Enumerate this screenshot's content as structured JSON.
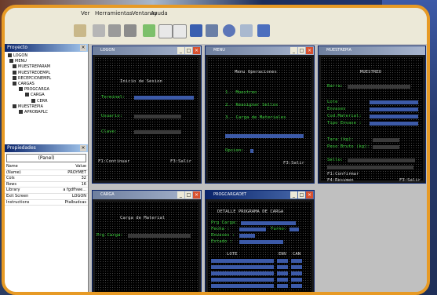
{
  "menu": {
    "item1": "Ver",
    "item2": "Herramientas",
    "item3": "Ventanas",
    "item4": "Ayuda"
  },
  "explorer": {
    "title": "Proyecto",
    "items": [
      "LOGON",
      "MENU",
      "MUESTREPARAM",
      "MUESTREOEMPL",
      "RECEPCIONEMPL",
      "CARGAS",
      "PROGCARGA",
      "CARGA",
      "CERR",
      "MUESTREPIA",
      "APROBAPLC"
    ]
  },
  "properties": {
    "title": "Propiedades",
    "selected": "(Panel)",
    "header": {
      "name": "Name",
      "value": "Value"
    },
    "rows": [
      {
        "name": "(Name)",
        "value": "PROYMET"
      },
      {
        "name": "Cols",
        "value": "32"
      },
      {
        "name": "Rows",
        "value": "16"
      },
      {
        "name": "Library",
        "value": "a fgdfhwe..."
      },
      {
        "name": "Exit Screen",
        "value": "LOGON"
      },
      {
        "name": "Instructions",
        "value": "Ptalbudcas"
      }
    ]
  },
  "windows": {
    "logon": {
      "title": "LOGON",
      "heading": "Inicio de Sesion",
      "lbl_terminal": "Terminal:",
      "lbl_usuario": "Usuario:",
      "lbl_clave": "Clave:",
      "f1": "F1:Continuar",
      "f3": "F3:Salir"
    },
    "menu": {
      "title": "MENU",
      "heading": "Menu Operaciones",
      "opt1": "1.- Muestreo",
      "opt2": "2.- Reasignar Sellos",
      "opt3": "3.- Carga de Materiales",
      "lbl_opcion": "Opcion:",
      "f3": "F3:Salir"
    },
    "muestreo": {
      "title": "MUESTREPIA",
      "heading": "MUESTREO",
      "lbl_barra": "Barra:",
      "lbl_lote": "Lote",
      "lbl_envases": "Envases",
      "lbl_cod": "Cod.Material:",
      "lbl_tipo": "Tipo Envase :",
      "lbl_tara": "Tara (kg):",
      "lbl_peso": "Peso Bruto (kg):",
      "lbl_sello": "Sello:",
      "f1": "F1:Confirmar",
      "f4": "F4:Resumen",
      "f3": "F3:Salir"
    },
    "carga": {
      "title": "CARGA",
      "heading": "Carga de Material",
      "lbl_prg": "Prg Carga:"
    },
    "progcarga": {
      "title": "PROGCARGADET",
      "heading": "DETALLE PROGRAMA DE CARGA",
      "lbl_prg": "Prg Carga:",
      "lbl_fecha": "Fecha   :",
      "lbl_envases": "Envases :",
      "lbl_estado": "Estado  :",
      "lbl_turno": "Turno:",
      "col_lote": "LOTE",
      "col_env": "ENV",
      "col_can": "CAN"
    }
  }
}
